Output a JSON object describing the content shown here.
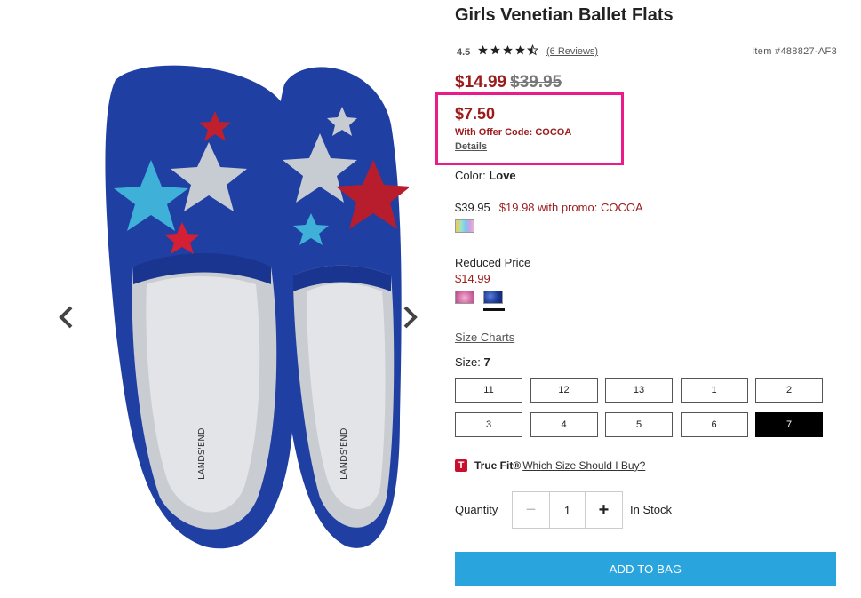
{
  "product": {
    "title": "Girls Venetian Ballet Flats",
    "rating": "4.5",
    "rating_value": 4.5,
    "reviews_link": "(6 Reviews)",
    "item_number": "Item #488827-AF3"
  },
  "pricing": {
    "sale_price": "$14.99",
    "original_price": "$39.95",
    "offer_price": "$7.50",
    "offer_code_text": "With Offer Code: COCOA",
    "details_link": "Details"
  },
  "color": {
    "label": "Color:",
    "value": "Love"
  },
  "promo": {
    "regular_price": "$39.95",
    "promo_text": "$19.98 with promo: COCOA"
  },
  "reduced": {
    "label": "Reduced Price",
    "price": "$14.99"
  },
  "size": {
    "charts_link": "Size Charts",
    "label": "Size:",
    "selected": "7",
    "options": [
      "11",
      "12",
      "13",
      "1",
      "2",
      "3",
      "4",
      "5",
      "6",
      "7"
    ]
  },
  "truefit": {
    "logo_letter": "T",
    "brand": "True Fit®",
    "link": "Which Size Should I Buy?"
  },
  "quantity": {
    "label": "Quantity",
    "value": "1",
    "minus": "−",
    "plus": "+",
    "stock": "In Stock"
  },
  "cta": {
    "add_to_bag": "ADD TO BAG"
  },
  "colors": {
    "sale_red": "#9b1b1b",
    "highlight_pink": "#ec1b8a",
    "button_blue": "#2aa4dd",
    "star": "#222222"
  },
  "icons": {
    "prev": "chevron-left-icon",
    "next": "chevron-right-icon",
    "star": "star-icon"
  }
}
